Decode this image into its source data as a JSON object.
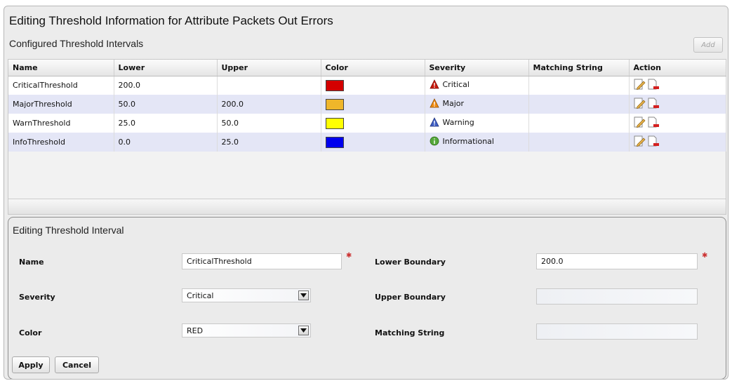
{
  "page": {
    "title": "Editing Threshold Information for Attribute Packets Out Errors"
  },
  "intervals": {
    "title": "Configured Threshold Intervals",
    "add_label": "Add",
    "columns": [
      "Name",
      "Lower",
      "Upper",
      "Color",
      "Severity",
      "Matching String",
      "Action"
    ],
    "rows": [
      {
        "name": "CriticalThreshold",
        "lower": "200.0",
        "upper": "",
        "color": "#d40000",
        "severity": "Critical",
        "severity_icon": "critical-icon",
        "matching": ""
      },
      {
        "name": "MajorThreshold",
        "lower": "50.0",
        "upper": "200.0",
        "color": "#efb62a",
        "severity": "Major",
        "severity_icon": "major-icon",
        "matching": ""
      },
      {
        "name": "WarnThreshold",
        "lower": "25.0",
        "upper": "50.0",
        "color": "#ffff00",
        "severity": "Warning",
        "severity_icon": "warning-icon",
        "matching": ""
      },
      {
        "name": "InfoThreshold",
        "lower": "0.0",
        "upper": "25.0",
        "color": "#0000ee",
        "severity": "Informational",
        "severity_icon": "info-icon",
        "matching": ""
      }
    ]
  },
  "editor": {
    "title": "Editing Threshold Interval",
    "name_label": "Name",
    "name_value": "CriticalThreshold",
    "severity_label": "Severity",
    "severity_value": "Critical",
    "color_label": "Color",
    "color_value": "RED",
    "lower_label": "Lower Boundary",
    "lower_value": "200.0",
    "upper_label": "Upper Boundary",
    "upper_value": "",
    "matching_label": "Matching String",
    "matching_value": "",
    "apply_label": "Apply",
    "cancel_label": "Cancel"
  }
}
